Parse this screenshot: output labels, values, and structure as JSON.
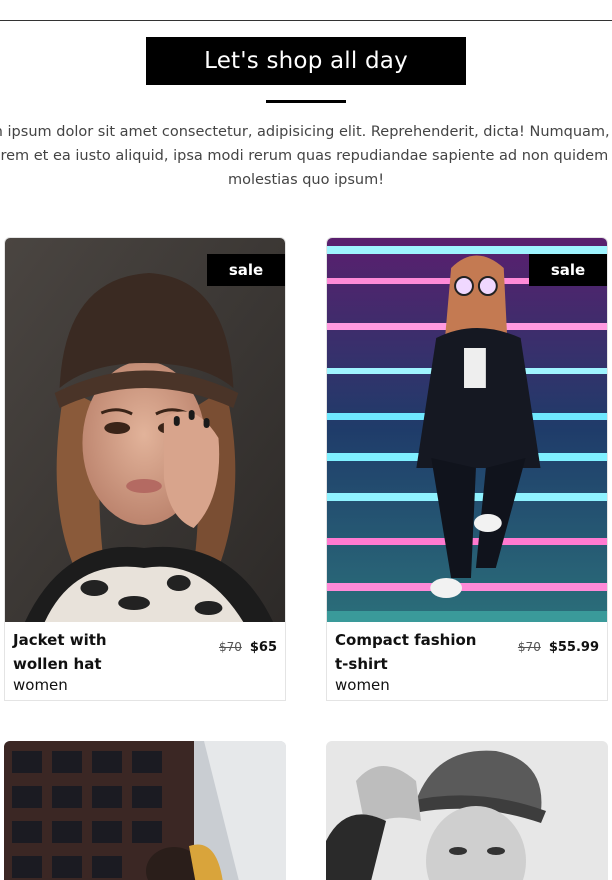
{
  "section": {
    "title": "Let's shop all day",
    "intro_lines": [
      "m ipsum dolor sit amet consectetur, adipisicing elit. Reprehenderit, dicta! Numquam, e",
      "orem et ea iusto aliquid, ipsa modi rerum quas repudiandae sapiente ad non quidem s",
      "molestias quo ipsum!"
    ]
  },
  "products": [
    {
      "name": "Jacket with wollen hat",
      "category": "women",
      "old_price": "$70",
      "new_price": "$65",
      "badge": "sale",
      "image": "woman-in-fur-hat-photo"
    },
    {
      "name": "Compact fashion t-shirt",
      "category": "women",
      "old_price": "$70",
      "new_price": "$55.99",
      "badge": "sale",
      "image": "woman-on-neon-stairs-photo"
    },
    {
      "image": "man-by-building-photo"
    },
    {
      "image": "woman-in-cap-bw-photo"
    }
  ],
  "colors": {
    "badge_bg": "#000000",
    "title_bg": "#000000",
    "accent": "#ffffff"
  }
}
